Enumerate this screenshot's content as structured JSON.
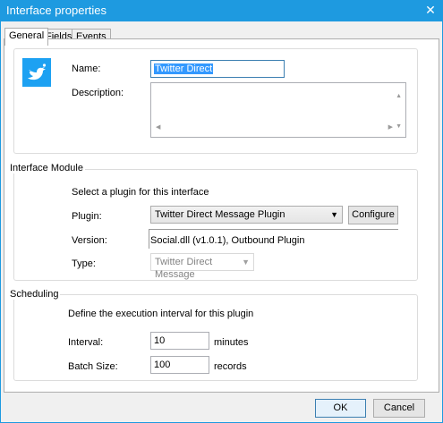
{
  "window": {
    "title": "Interface properties",
    "close_label": "✕"
  },
  "tabs": [
    {
      "label": "General"
    },
    {
      "label": "Fields"
    },
    {
      "label": "Events"
    }
  ],
  "identity": {
    "icon": "twitter-bird-icon",
    "name_label": "Name:",
    "name_value": "Twitter Direct",
    "description_label": "Description:",
    "description_value": ""
  },
  "interface_module": {
    "legend": "Interface Module",
    "instructions": "Select a plugin for this interface",
    "plugin_label": "Plugin:",
    "plugin_value": "Twitter Direct Message Plugin",
    "configure_label": "Configure",
    "version_label": "Version:",
    "version_value": "Social.dll (v1.0.1), Outbound Plugin",
    "type_label": "Type:",
    "type_value": "Twitter Direct Message"
  },
  "scheduling": {
    "legend": "Scheduling",
    "instructions": "Define the execution interval for this plugin",
    "interval_label": "Interval:",
    "interval_value": "10",
    "interval_unit": "minutes",
    "batch_label": "Batch Size:",
    "batch_value": "100",
    "batch_unit": "records"
  },
  "footer": {
    "ok_label": "OK",
    "cancel_label": "Cancel"
  },
  "colors": {
    "titlebar": "#1e9ae0",
    "twitter_tile": "#1da1f2",
    "selection": "#3399ff"
  }
}
